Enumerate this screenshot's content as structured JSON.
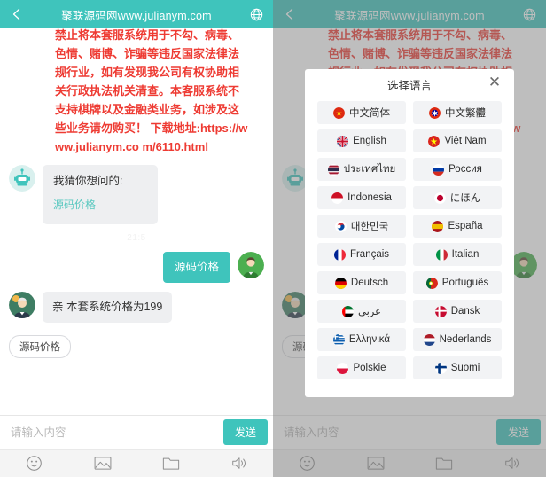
{
  "header": {
    "title": "聚联源码网www.julianym.com",
    "back_icon": "chevron-left-icon",
    "globe_icon": "globe-icon"
  },
  "chat": {
    "notice_lines": [
      "禁止将本套服系统用于不勾、病毒、",
      "色情、赌博、诈骗等违反国家法律法",
      "规行业，如有发现我公司有权协助相",
      "关行政执法机关清查。本客服系统不",
      "支持棋牌以及金融类业务，如涉及这",
      "些业务请勿购买！",
      "下载地址:https://www.julianym.co",
      "m/6110.html"
    ],
    "bot_message": {
      "title": "我猜你想问的:",
      "link": "源码价格"
    },
    "timestamp": "21:5",
    "user_message": "源码价格",
    "agent_message": "亲 本套系统价格为199",
    "quick_reply": "源码价格"
  },
  "input": {
    "placeholder": "请输入内容",
    "value": "",
    "send_label": "发送"
  },
  "toolbar": {
    "items": [
      {
        "name": "emoji-icon"
      },
      {
        "name": "image-icon"
      },
      {
        "name": "folder-icon"
      },
      {
        "name": "speaker-icon"
      }
    ]
  },
  "language_dialog": {
    "title": "选择语言",
    "close_label": "✕",
    "options": [
      {
        "label": "中文简体",
        "flag": "cn"
      },
      {
        "label": "中文繁體",
        "flag": "tw"
      },
      {
        "label": "English",
        "flag": "gb"
      },
      {
        "label": "Việt Nam",
        "flag": "vn"
      },
      {
        "label": "ประเทศไทย",
        "flag": "th"
      },
      {
        "label": "Россия",
        "flag": "ru"
      },
      {
        "label": "Indonesia",
        "flag": "id"
      },
      {
        "label": "にほん",
        "flag": "jp"
      },
      {
        "label": "대한민국",
        "flag": "kr"
      },
      {
        "label": "España",
        "flag": "es"
      },
      {
        "label": "Français",
        "flag": "fr"
      },
      {
        "label": "Italian",
        "flag": "it"
      },
      {
        "label": "Deutsch",
        "flag": "de"
      },
      {
        "label": "Português",
        "flag": "pt"
      },
      {
        "label": "عربي",
        "flag": "ae"
      },
      {
        "label": "Dansk",
        "flag": "dk"
      },
      {
        "label": "Ελληνικά",
        "flag": "gr"
      },
      {
        "label": "Nederlands",
        "flag": "nl"
      },
      {
        "label": "Polskie",
        "flag": "pl"
      },
      {
        "label": "Suomi",
        "flag": "fi"
      }
    ]
  },
  "colors": {
    "accent": "#3fc4bc",
    "notice_red": "#ee3b33",
    "bubble_gray": "#eeeff1",
    "link": "#5ac8c0"
  }
}
